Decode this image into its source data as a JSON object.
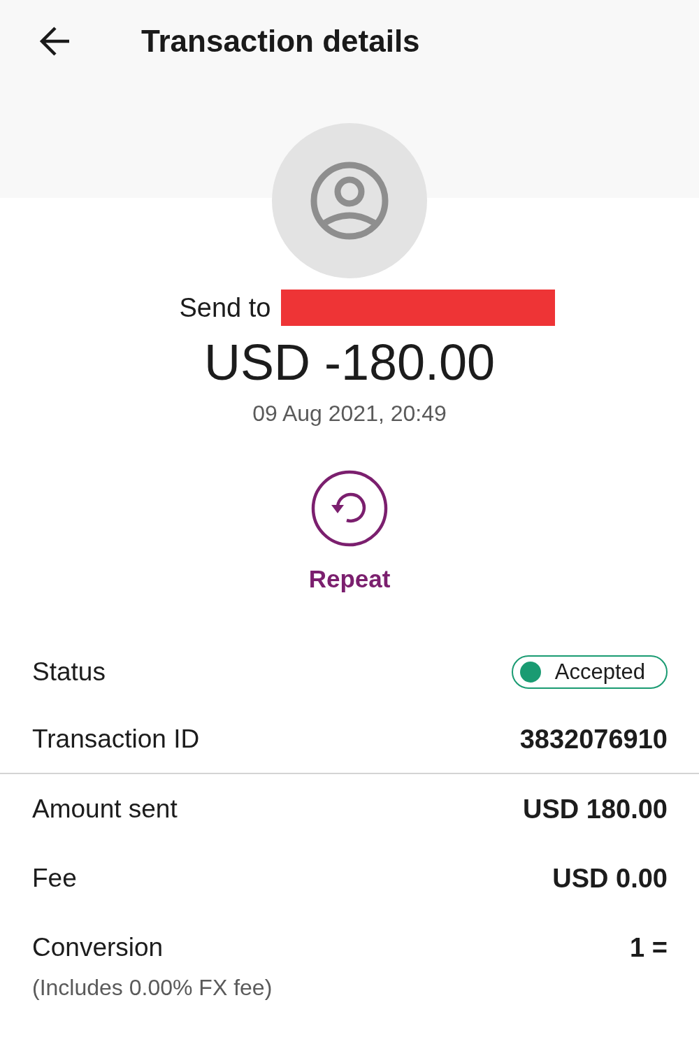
{
  "app_bar": {
    "title": "Transaction details"
  },
  "recipient": {
    "label": "Send to",
    "redacted": true
  },
  "amount": "USD -180.00",
  "date": "09 Aug 2021, 20:49",
  "actions": [
    {
      "kind": "repeat",
      "label": "Repeat"
    }
  ],
  "sections": [
    {
      "rows": [
        {
          "kind": "status",
          "label": "Status",
          "value": "Accepted",
          "color": "#1a9b72"
        },
        {
          "kind": "text",
          "label": "Transaction ID",
          "value": "3832076910"
        }
      ]
    },
    {
      "rows": [
        {
          "kind": "text",
          "label": "Amount sent",
          "value": "USD 180.00"
        },
        {
          "kind": "text",
          "label": "Fee",
          "value": "USD 0.00"
        },
        {
          "kind": "text",
          "label": "Conversion",
          "value": "1 =",
          "note": "(Includes 0.00% FX fee)"
        }
      ]
    }
  ]
}
